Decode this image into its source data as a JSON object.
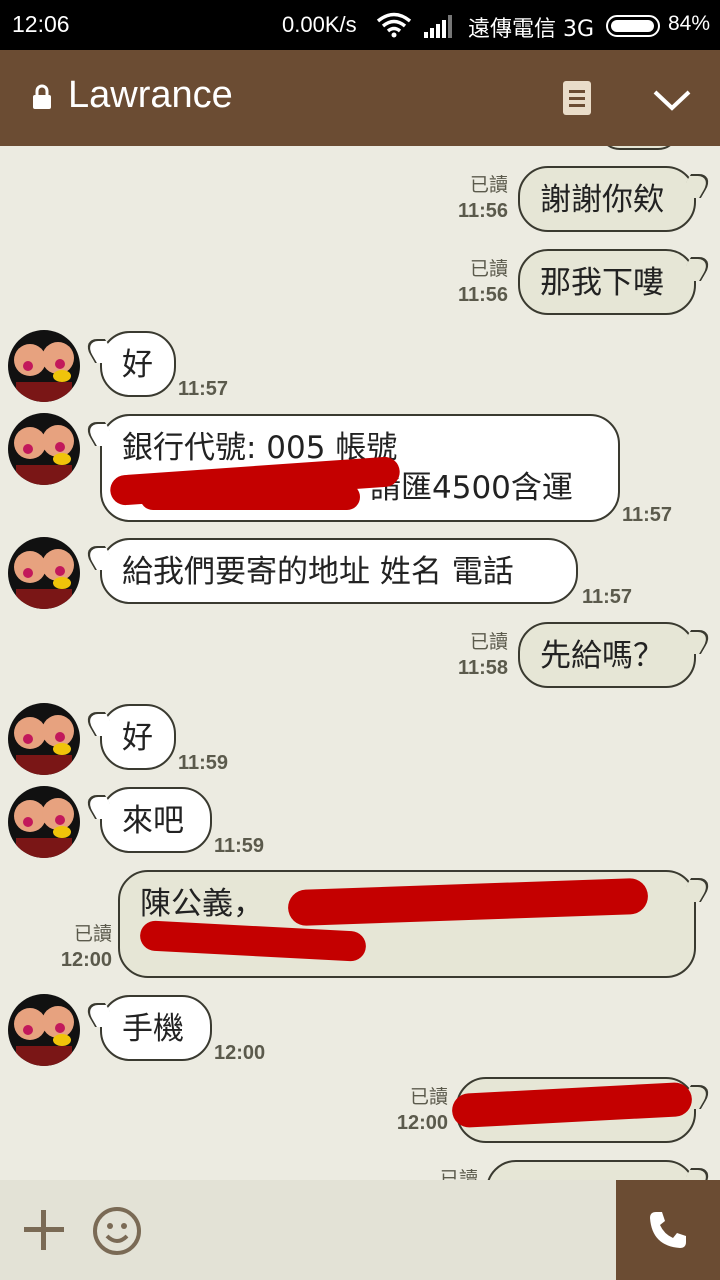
{
  "status_bar": {
    "time": "12:06",
    "speed": "0.00K/s",
    "carrier": "遠傳電信 3G",
    "battery": "84%",
    "battery_level": 0.84
  },
  "header": {
    "title": "Lawrance",
    "icons": [
      "lock-icon",
      "notes-icon",
      "chevron-down-icon"
    ],
    "color": "#6b4c33"
  },
  "messages": [
    {
      "dir": "out",
      "text": "謝謝你欸",
      "read": "已讀",
      "time": "11:56"
    },
    {
      "dir": "out",
      "text": "那我下嘍",
      "read": "已讀",
      "time": "11:56"
    },
    {
      "dir": "in",
      "text": "好",
      "time": "11:57"
    },
    {
      "dir": "in",
      "line1": "銀行代號: 005 帳號",
      "line2": "請匯4500含運",
      "time": "11:57"
    },
    {
      "dir": "in",
      "text": "給我們要寄的地址 姓名 電話",
      "time": "11:57"
    },
    {
      "dir": "out",
      "text": "先給嗎？",
      "read": "已讀",
      "time": "11:58"
    },
    {
      "dir": "in",
      "text": "好",
      "time": "11:59"
    },
    {
      "dir": "in",
      "text": "來吧",
      "time": "11:59"
    },
    {
      "dir": "out",
      "text": "陳公義，",
      "read": "已讀",
      "time": "12:00"
    },
    {
      "dir": "in",
      "text": "手機",
      "time": "12:00"
    },
    {
      "dir": "out",
      "text": "",
      "read": "已讀",
      "time": "12:00"
    },
    {
      "dir": "out",
      "text": "",
      "read": "已讀",
      "time": ""
    }
  ],
  "input_bar": {
    "icons": [
      "plus-icon",
      "emoji-icon",
      "phone-icon"
    ]
  }
}
